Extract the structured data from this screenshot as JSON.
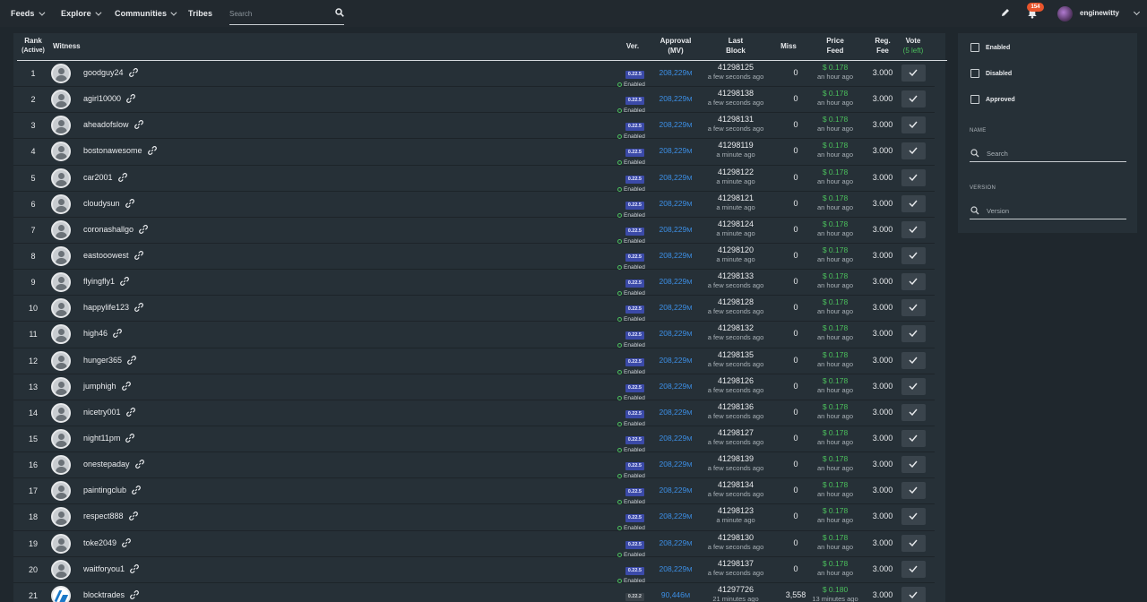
{
  "nav": {
    "items": [
      {
        "label": "Feeds",
        "dropdown": true
      },
      {
        "label": "Explore",
        "dropdown": true
      },
      {
        "label": "Communities",
        "dropdown": true
      },
      {
        "label": "Tribes",
        "dropdown": false
      }
    ],
    "search_placeholder": "Search",
    "notifications_count": "154",
    "username": "enginewitty",
    "icons": [
      "pencil-icon",
      "bell-icon",
      "search-icon",
      "chevron-down-icon"
    ]
  },
  "table": {
    "headers": {
      "rank": "Rank",
      "rank_sub": "(Active)",
      "witness": "Witness",
      "ver": "Ver.",
      "approval": "Approval",
      "approval_sub": "(MV)",
      "last_block": "Last",
      "last_block_sub": "Block",
      "miss": "Miss",
      "price_feed": "Price",
      "price_feed_sub": "Feed",
      "reg_fee": "Reg.",
      "reg_fee_sub": "Fee",
      "vote": "Vote",
      "vote_sub": "(5 left)"
    },
    "rows": [
      {
        "rank": "1",
        "name": "goodguy24",
        "version": "0.22.5",
        "status": "Enabled",
        "approval": "208,229",
        "approval_unit": "M",
        "block": "41298125",
        "block_time": "a few seconds ago",
        "miss": "0",
        "price": "$ 0.178",
        "price_time": "an hour ago",
        "fee": "3.000"
      },
      {
        "rank": "2",
        "name": "agirl10000",
        "version": "0.22.5",
        "status": "Enabled",
        "approval": "208,229",
        "approval_unit": "M",
        "block": "41298138",
        "block_time": "a few seconds ago",
        "miss": "0",
        "price": "$ 0.178",
        "price_time": "an hour ago",
        "fee": "3.000"
      },
      {
        "rank": "3",
        "name": "aheadofslow",
        "version": "0.22.5",
        "status": "Enabled",
        "approval": "208,229",
        "approval_unit": "M",
        "block": "41298131",
        "block_time": "a few seconds ago",
        "miss": "0",
        "price": "$ 0.178",
        "price_time": "an hour ago",
        "fee": "3.000"
      },
      {
        "rank": "4",
        "name": "bostonawesome",
        "version": "0.22.5",
        "status": "Enabled",
        "approval": "208,229",
        "approval_unit": "M",
        "block": "41298119",
        "block_time": "a minute ago",
        "miss": "0",
        "price": "$ 0.178",
        "price_time": "an hour ago",
        "fee": "3.000"
      },
      {
        "rank": "5",
        "name": "car2001",
        "version": "0.22.5",
        "status": "Enabled",
        "approval": "208,229",
        "approval_unit": "M",
        "block": "41298122",
        "block_time": "a minute ago",
        "miss": "0",
        "price": "$ 0.178",
        "price_time": "an hour ago",
        "fee": "3.000"
      },
      {
        "rank": "6",
        "name": "cloudysun",
        "version": "0.22.5",
        "status": "Enabled",
        "approval": "208,229",
        "approval_unit": "M",
        "block": "41298121",
        "block_time": "a minute ago",
        "miss": "0",
        "price": "$ 0.178",
        "price_time": "an hour ago",
        "fee": "3.000"
      },
      {
        "rank": "7",
        "name": "coronashallgo",
        "version": "0.22.5",
        "status": "Enabled",
        "approval": "208,229",
        "approval_unit": "M",
        "block": "41298124",
        "block_time": "a minute ago",
        "miss": "0",
        "price": "$ 0.178",
        "price_time": "an hour ago",
        "fee": "3.000"
      },
      {
        "rank": "8",
        "name": "eastooowest",
        "version": "0.22.5",
        "status": "Enabled",
        "approval": "208,229",
        "approval_unit": "M",
        "block": "41298120",
        "block_time": "a minute ago",
        "miss": "0",
        "price": "$ 0.178",
        "price_time": "an hour ago",
        "fee": "3.000"
      },
      {
        "rank": "9",
        "name": "flyingfly1",
        "version": "0.22.5",
        "status": "Enabled",
        "approval": "208,229",
        "approval_unit": "M",
        "block": "41298133",
        "block_time": "a few seconds ago",
        "miss": "0",
        "price": "$ 0.178",
        "price_time": "an hour ago",
        "fee": "3.000"
      },
      {
        "rank": "10",
        "name": "happylife123",
        "version": "0.22.5",
        "status": "Enabled",
        "approval": "208,229",
        "approval_unit": "M",
        "block": "41298128",
        "block_time": "a few seconds ago",
        "miss": "0",
        "price": "$ 0.178",
        "price_time": "an hour ago",
        "fee": "3.000"
      },
      {
        "rank": "11",
        "name": "high46",
        "version": "0.22.5",
        "status": "Enabled",
        "approval": "208,229",
        "approval_unit": "M",
        "block": "41298132",
        "block_time": "a few seconds ago",
        "miss": "0",
        "price": "$ 0.178",
        "price_time": "an hour ago",
        "fee": "3.000"
      },
      {
        "rank": "12",
        "name": "hunger365",
        "version": "0.22.5",
        "status": "Enabled",
        "approval": "208,229",
        "approval_unit": "M",
        "block": "41298135",
        "block_time": "a few seconds ago",
        "miss": "0",
        "price": "$ 0.178",
        "price_time": "an hour ago",
        "fee": "3.000"
      },
      {
        "rank": "13",
        "name": "jumphigh",
        "version": "0.22.5",
        "status": "Enabled",
        "approval": "208,229",
        "approval_unit": "M",
        "block": "41298126",
        "block_time": "a few seconds ago",
        "miss": "0",
        "price": "$ 0.178",
        "price_time": "an hour ago",
        "fee": "3.000"
      },
      {
        "rank": "14",
        "name": "nicetry001",
        "version": "0.22.5",
        "status": "Enabled",
        "approval": "208,229",
        "approval_unit": "M",
        "block": "41298136",
        "block_time": "a few seconds ago",
        "miss": "0",
        "price": "$ 0.178",
        "price_time": "an hour ago",
        "fee": "3.000"
      },
      {
        "rank": "15",
        "name": "night11pm",
        "version": "0.22.5",
        "status": "Enabled",
        "approval": "208,229",
        "approval_unit": "M",
        "block": "41298127",
        "block_time": "a few seconds ago",
        "miss": "0",
        "price": "$ 0.178",
        "price_time": "an hour ago",
        "fee": "3.000"
      },
      {
        "rank": "16",
        "name": "onestepaday",
        "version": "0.22.5",
        "status": "Enabled",
        "approval": "208,229",
        "approval_unit": "M",
        "block": "41298139",
        "block_time": "a few seconds ago",
        "miss": "0",
        "price": "$ 0.178",
        "price_time": "an hour ago",
        "fee": "3.000"
      },
      {
        "rank": "17",
        "name": "paintingclub",
        "version": "0.22.5",
        "status": "Enabled",
        "approval": "208,229",
        "approval_unit": "M",
        "block": "41298134",
        "block_time": "a few seconds ago",
        "miss": "0",
        "price": "$ 0.178",
        "price_time": "an hour ago",
        "fee": "3.000"
      },
      {
        "rank": "18",
        "name": "respect888",
        "version": "0.22.5",
        "status": "Enabled",
        "approval": "208,229",
        "approval_unit": "M",
        "block": "41298123",
        "block_time": "a minute ago",
        "miss": "0",
        "price": "$ 0.178",
        "price_time": "an hour ago",
        "fee": "3.000"
      },
      {
        "rank": "19",
        "name": "toke2049",
        "version": "0.22.5",
        "status": "Enabled",
        "approval": "208,229",
        "approval_unit": "M",
        "block": "41298130",
        "block_time": "a few seconds ago",
        "miss": "0",
        "price": "$ 0.178",
        "price_time": "an hour ago",
        "fee": "3.000"
      },
      {
        "rank": "20",
        "name": "waitforyou1",
        "version": "0.22.5",
        "status": "Enabled",
        "approval": "208,229",
        "approval_unit": "M",
        "block": "41298137",
        "block_time": "a few seconds ago",
        "miss": "0",
        "price": "$ 0.178",
        "price_time": "an hour ago",
        "fee": "3.000"
      },
      {
        "rank": "21",
        "name": "blocktrades",
        "version": "0.22.2",
        "status": "Enabled",
        "approval": "90,446",
        "approval_unit": "M",
        "block": "41297726",
        "block_time": "21 minutes ago",
        "miss": "3,558",
        "price": "$ 0.180",
        "price_time": "13 minutes ago",
        "fee": "3.000"
      }
    ]
  },
  "filters": {
    "checkboxes": [
      "Enabled",
      "Disabled",
      "Approved"
    ],
    "name_label": "NAME",
    "name_placeholder": "Search",
    "version_label": "VERSION",
    "version_placeholder": "Version"
  },
  "colors": {
    "background": "#1f272d",
    "panel": "#263037",
    "link_blue": "#3c8fe6",
    "green": "#4bbf5c",
    "version_badge": "#3b4aa8",
    "notif_badge": "#e8552c"
  }
}
